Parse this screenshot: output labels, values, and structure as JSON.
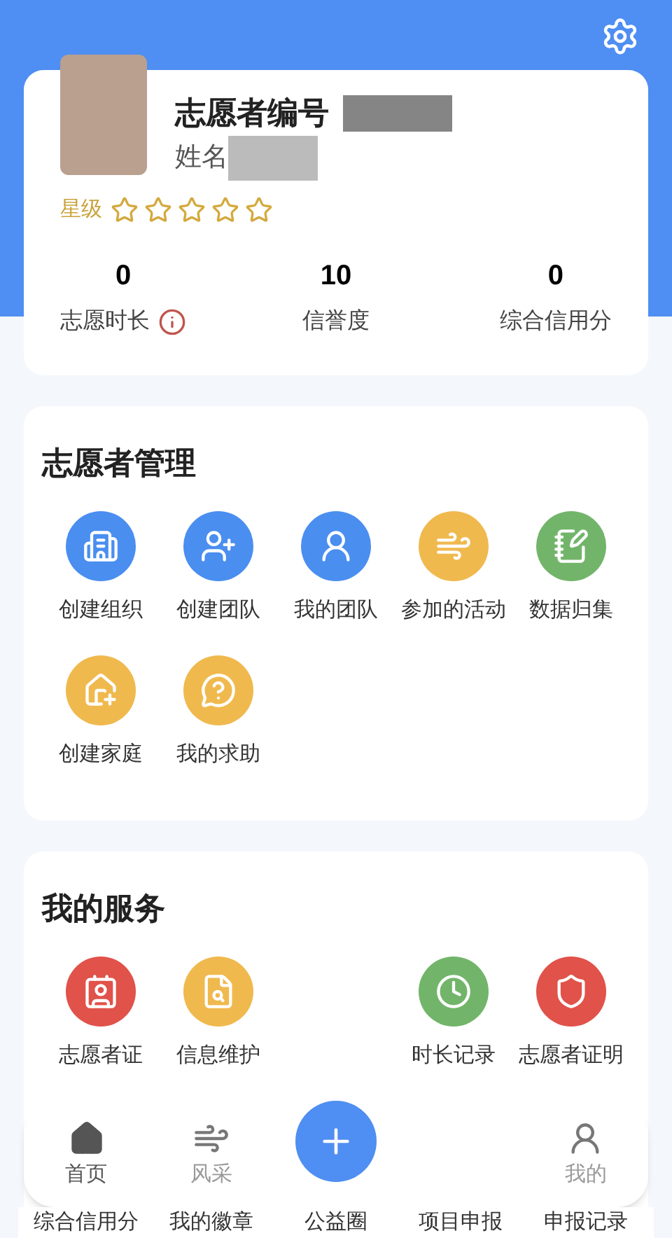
{
  "profile": {
    "id_label": "志愿者编号",
    "name_label": "姓名",
    "star_label": "星级",
    "stars": 0,
    "stats": [
      {
        "value": "0",
        "label": "志愿时长",
        "info": true
      },
      {
        "value": "10",
        "label": "信誉度",
        "info": false
      },
      {
        "value": "0",
        "label": "综合信用分",
        "info": false
      }
    ]
  },
  "management": {
    "title": "志愿者管理",
    "items": [
      {
        "label": "创建组织",
        "color": "#4a8ef0"
      },
      {
        "label": "创建团队",
        "color": "#4a8ef0"
      },
      {
        "label": "我的团队",
        "color": "#4a8ef0"
      },
      {
        "label": "参加的活动",
        "color": "#f0b94e"
      },
      {
        "label": "数据归集",
        "color": "#72b56a"
      },
      {
        "label": "创建家庭",
        "color": "#f0b94e"
      },
      {
        "label": "我的求助",
        "color": "#f0b94e"
      }
    ]
  },
  "services": {
    "title": "我的服务",
    "items": [
      {
        "label": "志愿者证",
        "color": "#e0524a"
      },
      {
        "label": "信息维护",
        "color": "#f0b94e"
      },
      {
        "label": "时长记录",
        "color": "#72b56a"
      },
      {
        "label": "志愿者证明",
        "color": "#e0524a"
      }
    ],
    "more": [
      "综合信用分",
      "我的徽章",
      "公益圈",
      "项目申报",
      "申报记录"
    ]
  },
  "tabbar": [
    {
      "kind": "tab",
      "label": "首页",
      "selected": true
    },
    {
      "kind": "tab",
      "label": "风采",
      "selected": false
    },
    {
      "kind": "center",
      "selected": false
    },
    {
      "kind": "tab",
      "label": "我的",
      "selected": false
    }
  ]
}
